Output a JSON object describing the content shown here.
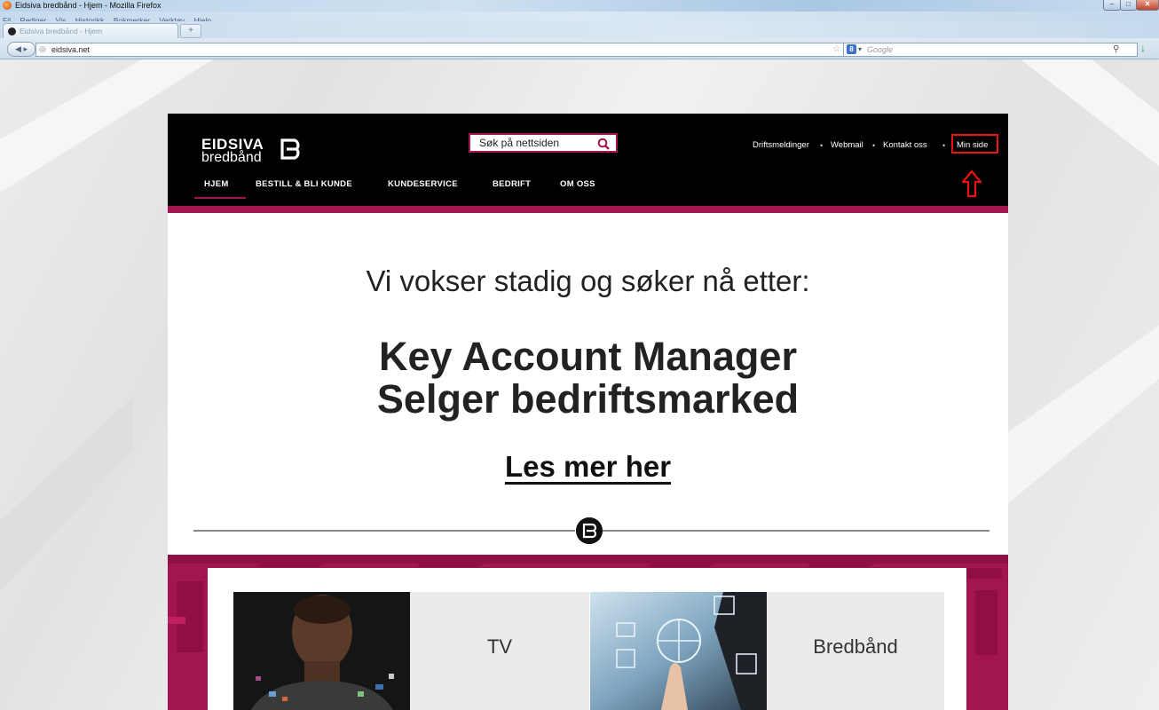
{
  "browser": {
    "window_title": "Eidsiva bredbånd - Hjem - Mozilla Firefox",
    "menu": [
      "Fil",
      "Rediger",
      "Vis",
      "Historikk",
      "Bokmerker",
      "Verktøy",
      "Hjelp"
    ],
    "tab_title": "Eidsiva bredbånd - Hjem",
    "new_tab_symbol": "+",
    "url": "eidsiva.net",
    "search_engine": "Google",
    "search_placeholder": "Google"
  },
  "site": {
    "logo_line1": "EIDSIVA",
    "logo_line2": "bredbånd",
    "search_placeholder": "Søk på nettsiden",
    "top_links": [
      "Driftsmeldinger",
      "Webmail",
      "Kontakt oss",
      "Min side"
    ],
    "nav": [
      "HJEM",
      "BESTILL & BLI KUNDE",
      "KUNDESERVICE",
      "BEDRIFT",
      "OM OSS"
    ],
    "active_nav": "HJEM",
    "hero": {
      "intro": "Vi vokser stadig og søker nå etter:",
      "position1": "Key Account Manager",
      "position2": "Selger bedriftsmarked",
      "link": "Les mer her"
    },
    "cards": [
      {
        "label": "TV"
      },
      {
        "label": "Bredbånd"
      }
    ],
    "colors": {
      "brand_magenta": "#a3154e",
      "header_bg": "#000000",
      "highlight_red": "#e11111"
    }
  }
}
